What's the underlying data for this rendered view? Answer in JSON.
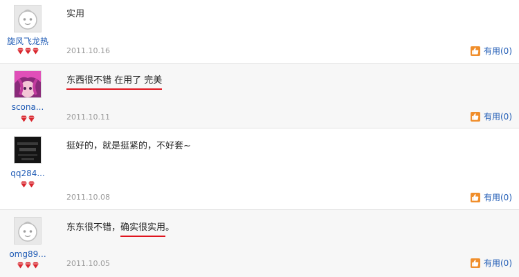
{
  "reviews": [
    {
      "username": "旋风飞龙热",
      "avatar": "default-avatar-icon",
      "gems": 3,
      "text_parts": [
        {
          "t": "实用",
          "u": false
        }
      ],
      "date": "2011.10.16",
      "useful_label": "有用(0)"
    },
    {
      "username": "scona...",
      "avatar": "anime-avatar-icon",
      "gems": 2,
      "text_parts": [
        {
          "t": "东西很不错",
          "u": true
        },
        {
          "t": " 在用了 ",
          "u": true
        },
        {
          "t": "完美",
          "u": true
        }
      ],
      "date": "2011.10.11",
      "useful_label": "有用(0)"
    },
    {
      "username": "qq284...",
      "avatar": "dark-photo-avatar-icon",
      "gems": 2,
      "text_parts": [
        {
          "t": "挺好的，就是挺紧的，不好套~",
          "u": false
        }
      ],
      "date": "2011.10.08",
      "useful_label": "有用(0)"
    },
    {
      "username": "omg89...",
      "avatar": "default-avatar-icon",
      "gems": 3,
      "text_parts": [
        {
          "t": "东东很不错，",
          "u": false
        },
        {
          "t": "确实很实用",
          "u": true
        },
        {
          "t": "。",
          "u": false
        }
      ],
      "date": "2011.10.05",
      "useful_label": "有用(0)"
    }
  ],
  "colors": {
    "link": "#1f5bb5",
    "underline": "#e0141e",
    "date": "#9a9a9a",
    "gem": "#d9262e",
    "thumb": "#f08e2b"
  }
}
